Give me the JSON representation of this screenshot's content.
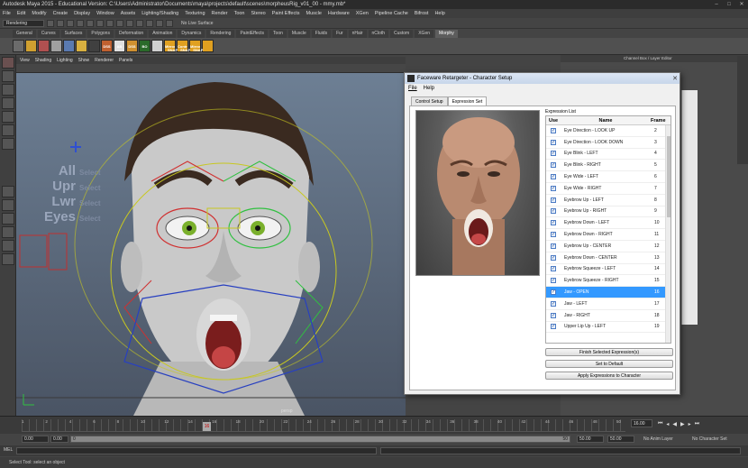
{
  "app": {
    "title": "Autodesk Maya 2015 - Educational Version: C:\\Users\\Administrator\\Documents\\maya\\projects\\default\\scenes\\morpheusRig_v01_00 - mmy.mb*",
    "window_controls": [
      "–",
      "□",
      "✕"
    ]
  },
  "menu": [
    "File",
    "Edit",
    "Modify",
    "Create",
    "Display",
    "Window",
    "Assets",
    "Lighting/Shading",
    "Texturing",
    "Render",
    "Toon",
    "Stereo",
    "Paint Effects",
    "Muscle",
    "Hardware",
    "XGen",
    "Pipeline Cache",
    "Bifrost",
    "Help"
  ],
  "status_line": {
    "mode": "Rendering",
    "live_surface": "No Live Surface"
  },
  "shelf_tabs": [
    "General",
    "Curves",
    "Surfaces",
    "Polygons",
    "Deformation",
    "Animation",
    "Dynamics",
    "Rendering",
    "PaintEffects",
    "Toon",
    "Muscle",
    "Fluids",
    "Fur",
    "nHair",
    "nCloth",
    "Custom",
    "XGen",
    "Morphy"
  ],
  "shelf_active": "Morphy",
  "shelf_icons": [
    {
      "label": "",
      "color": "#6b6b6b"
    },
    {
      "label": "",
      "color": "#d0a030"
    },
    {
      "label": "",
      "color": "#b05050"
    },
    {
      "label": "",
      "color": "#a0a0a0"
    },
    {
      "label": "",
      "color": "#5a7ab0"
    },
    {
      "label": "",
      "color": "#d8b040"
    },
    {
      "label": "",
      "color": "#404040"
    },
    {
      "label": "DSS",
      "color": "#c06030"
    },
    {
      "label": "AB",
      "color": "#e0e0e0"
    },
    {
      "label": "DSS",
      "color": "#d09030"
    },
    {
      "label": "BO",
      "color": "#2a6a2a"
    },
    {
      "label": "",
      "color": "#d0d0d0"
    },
    {
      "label": "Mirror",
      "color": "#e0a020"
    },
    {
      "label": "Control",
      "color": "#e0a020"
    },
    {
      "label": "Mirror",
      "color": "#e0a020"
    },
    {
      "label": "",
      "color": "#e0a020"
    }
  ],
  "shelf_snap_labels": [
    "SNAP",
    "SNAP",
    "SNAP"
  ],
  "right_panel": {
    "header": "Channel Box / Layer Editor"
  },
  "viewport": {
    "menu": [
      "View",
      "Shading",
      "Lighting",
      "Show",
      "Renderer",
      "Panels"
    ],
    "select_labels": [
      {
        "big": "All",
        "small": "Select"
      },
      {
        "big": "Upr",
        "small": "Select"
      },
      {
        "big": "Lwr",
        "small": "Select"
      },
      {
        "big": "Eyes",
        "small": "Select"
      }
    ],
    "camera_label": "persp"
  },
  "dialog": {
    "title": "Faceware Retargeter - Character Setup",
    "menu": [
      "File",
      "Help"
    ],
    "tabs": [
      "Control Setup",
      "Expression Set"
    ],
    "active_tab": "Expression Set",
    "expression_list_label": "Expression List",
    "columns": {
      "use": "Use",
      "name": "Name",
      "frame": "Frame"
    },
    "rows": [
      {
        "name": "Eye Direction - LOOK UP",
        "frame": "2",
        "checked": true
      },
      {
        "name": "Eye Direction - LOOK DOWN",
        "frame": "3",
        "checked": true
      },
      {
        "name": "Eye Blink - LEFT",
        "frame": "4",
        "checked": true
      },
      {
        "name": "Eye Blink - RIGHT",
        "frame": "5",
        "checked": true
      },
      {
        "name": "Eye Wide - LEFT",
        "frame": "6",
        "checked": true
      },
      {
        "name": "Eye Wide - RIGHT",
        "frame": "7",
        "checked": true
      },
      {
        "name": "Eyebrow Up - LEFT",
        "frame": "8",
        "checked": true
      },
      {
        "name": "Eyebrow Up - RIGHT",
        "frame": "9",
        "checked": true
      },
      {
        "name": "Eyebrow Down - LEFT",
        "frame": "10",
        "checked": true
      },
      {
        "name": "Eyebrow Down - RIGHT",
        "frame": "11",
        "checked": true
      },
      {
        "name": "Eyebrow Up - CENTER",
        "frame": "12",
        "checked": true
      },
      {
        "name": "Eyebrow Down - CENTER",
        "frame": "13",
        "checked": true
      },
      {
        "name": "Eyebrow Squeeze - LEFT",
        "frame": "14",
        "checked": true
      },
      {
        "name": "Eyebrow Squeeze - RIGHT",
        "frame": "15",
        "checked": true
      },
      {
        "name": "Jaw - OPEN",
        "frame": "16",
        "checked": true,
        "selected": true
      },
      {
        "name": "Jaw - LEFT",
        "frame": "17",
        "checked": true
      },
      {
        "name": "Jaw - RIGHT",
        "frame": "18",
        "checked": true
      },
      {
        "name": "Upper Lip Up - LEFT",
        "frame": "19",
        "checked": true
      }
    ],
    "buttons": {
      "finish": "Finish Selected Expression(s)",
      "default": "Set to Default",
      "apply": "Apply Expressions to Character"
    }
  },
  "timeline": {
    "current_frame": "16",
    "end_field": "16.00",
    "tick_labels": [
      "1",
      "2",
      "4",
      "6",
      "8",
      "10",
      "12",
      "14",
      "16",
      "18",
      "20",
      "22",
      "24",
      "26",
      "28",
      "30",
      "32",
      "34",
      "36",
      "38",
      "40",
      "42",
      "44",
      "46",
      "48",
      "50"
    ]
  },
  "range": {
    "start": "0.00",
    "inner_start": "0.00",
    "inner_label": "0",
    "inner_end": "50",
    "end": "50.00",
    "end2": "50.00",
    "anim_layer": "No Anim Layer",
    "char_set": "No Character Set"
  },
  "cmdline": {
    "label": "MEL"
  },
  "helpline": {
    "text": "Select Tool: select an object"
  }
}
